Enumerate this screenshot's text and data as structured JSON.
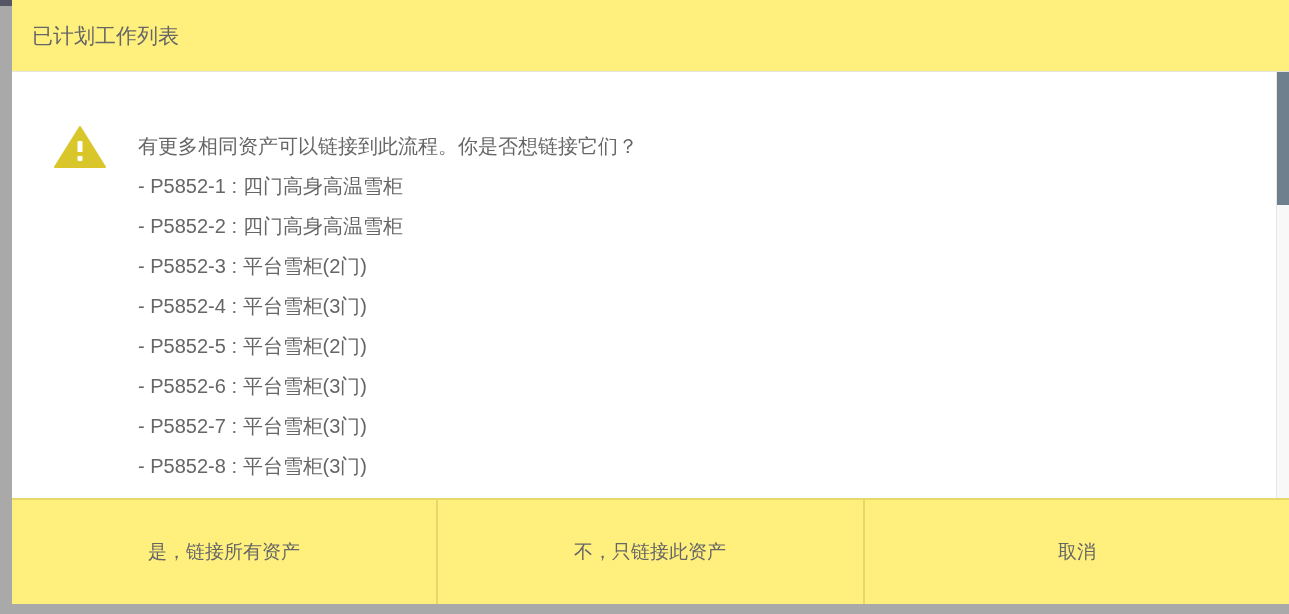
{
  "dialog": {
    "title": "已计划工作列表",
    "message": "有更多相同资产可以链接到此流程。你是否想链接它们？",
    "assets": [
      "- P5852-1 : 四门高身高温雪柜",
      "- P5852-2 : 四门高身高温雪柜",
      "- P5852-3 : 平台雪柜(2门)",
      "- P5852-4 : 平台雪柜(3门)",
      "- P5852-5 : 平台雪柜(2门)",
      "- P5852-6 : 平台雪柜(3门)",
      "- P5852-7 : 平台雪柜(3门)",
      "- P5852-8 : 平台雪柜(3门)"
    ],
    "buttons": [
      "是，链接所有资产",
      "不，只链接此资产",
      "取消"
    ]
  }
}
